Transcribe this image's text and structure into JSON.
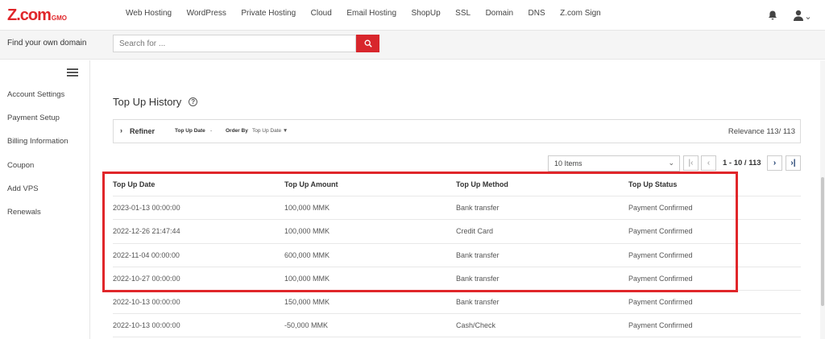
{
  "brand": {
    "logo_main": "Z.com",
    "logo_sub": "GMO",
    "accent": "#e0262a"
  },
  "nav": {
    "links": [
      "Web Hosting",
      "WordPress",
      "Private Hosting",
      "Cloud",
      "Email Hosting",
      "ShopUp",
      "SSL",
      "Domain",
      "DNS",
      "Z.com Sign"
    ]
  },
  "search": {
    "label": "Find your own domain",
    "placeholder": "Search for ..."
  },
  "sidebar": {
    "items": [
      "Account Settings",
      "Payment Setup",
      "Billing Information",
      "Coupon",
      "Add VPS",
      "Renewals"
    ]
  },
  "page": {
    "title": "Top Up History",
    "help": "?"
  },
  "refiner": {
    "label": "Refiner",
    "filter1_label": "Top Up Date",
    "filter1_value": "-",
    "filter2_label": "Order By",
    "filter2_value": "Top Up Date ▼",
    "relevance": "Relevance 113/ 113"
  },
  "pagination": {
    "items_select": "10 Items",
    "range": "1 - 10 / 113"
  },
  "table": {
    "headers": [
      "Top Up Date",
      "Top Up Amount",
      "Top Up Method",
      "Top Up Status"
    ],
    "rows": [
      [
        "2023-01-13 00:00:00",
        "100,000 MMK",
        "Bank transfer",
        "Payment Confirmed"
      ],
      [
        "2022-12-26 21:47:44",
        "100,000 MMK",
        "Credit Card",
        "Payment Confirmed"
      ],
      [
        "2022-11-04 00:00:00",
        "600,000 MMK",
        "Bank transfer",
        "Payment Confirmed"
      ],
      [
        "2022-10-27 00:00:00",
        "100,000 MMK",
        "Bank transfer",
        "Payment Confirmed"
      ],
      [
        "2022-10-13 00:00:00",
        "150,000 MMK",
        "Bank transfer",
        "Payment Confirmed"
      ],
      [
        "2022-10-13 00:00:00",
        "-50,000 MMK",
        "Cash/Check",
        "Payment Confirmed"
      ]
    ]
  }
}
